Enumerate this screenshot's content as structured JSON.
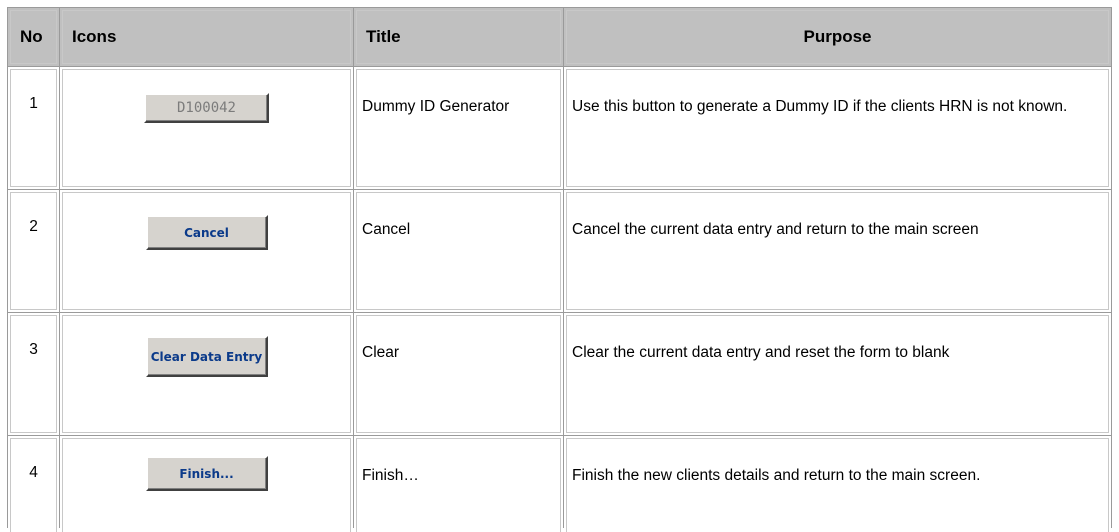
{
  "table": {
    "headers": {
      "no": "No",
      "icons": "Icons",
      "title": "Title",
      "purpose": "Purpose"
    },
    "rows": [
      {
        "no": "1",
        "button_label": "D100042",
        "title": "Dummy ID Generator",
        "purpose": "Use this button to generate a Dummy ID if the clients HRN is not known."
      },
      {
        "no": "2",
        "button_label": "Cancel",
        "title": "Cancel",
        "purpose": "Cancel the current data entry and return to the main screen"
      },
      {
        "no": "3",
        "button_label": "Clear Data Entry",
        "title": "Clear",
        "purpose": "Clear the current data entry and reset the form to blank"
      },
      {
        "no": "4",
        "button_label": "Finish...",
        "title": "Finish…",
        "purpose": "Finish the new clients details and return to the main screen."
      }
    ]
  },
  "colors": {
    "header_bg": "#c0c0c0",
    "button_face": "#d6d3ce",
    "button_text": "#0b3a8a",
    "dummy_text": "#7c7c7c"
  }
}
